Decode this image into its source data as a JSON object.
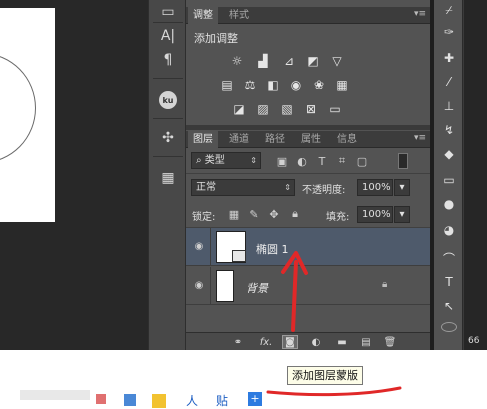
{
  "adjust_panel": {
    "tabs": [
      "调整",
      "样式"
    ],
    "title": "添加调整",
    "menu_icon": "panel-menu-icon"
  },
  "layers_panel": {
    "tabs": [
      "图层",
      "通道",
      "路径",
      "属性",
      "信息"
    ],
    "filter_kind": "类型",
    "blend_mode": "正常",
    "opacity_label": "不透明度:",
    "opacity_value": "100%",
    "lock_label": "锁定:",
    "fill_label": "填充:",
    "fill_value": "100%",
    "layers": [
      {
        "name": "椭圆 1",
        "selected": true
      },
      {
        "name": "背景",
        "selected": false,
        "locked": true
      }
    ]
  },
  "tooltip": {
    "text": "添加图层蒙版"
  },
  "colors": {
    "panel_bg": "#535353",
    "selected_layer": "#4f5a6c",
    "annotation_red": "#e02828"
  },
  "tools_status": "66"
}
